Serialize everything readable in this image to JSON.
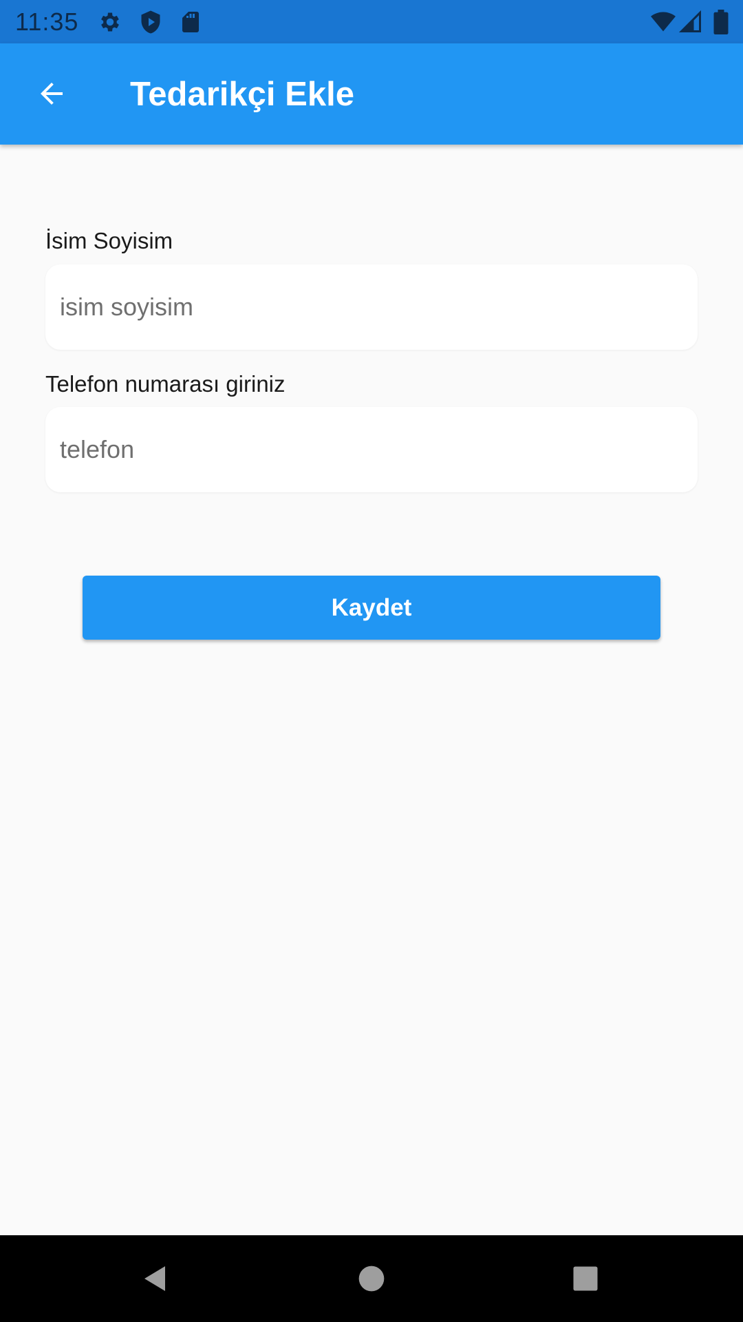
{
  "status_bar": {
    "time": "11:35",
    "icons": [
      "settings-icon",
      "shield-play-icon",
      "sd-card-icon",
      "wifi-icon",
      "signal-icon",
      "battery-icon"
    ]
  },
  "app_bar": {
    "title": "Tedarikçi Ekle",
    "back_icon": "arrow-left-icon",
    "color": "#2196f3"
  },
  "form": {
    "name": {
      "label": "İsim Soyisim",
      "placeholder": "isim soyisim",
      "value": ""
    },
    "phone": {
      "label": "Telefon numarası giriniz",
      "placeholder": "telefon",
      "value": ""
    },
    "save_label": "Kaydet"
  },
  "nav_bar": {
    "icons": [
      "back-triangle-icon",
      "home-circle-icon",
      "recents-square-icon"
    ]
  },
  "colors": {
    "status_bar": "#1976d2",
    "primary": "#2196f3",
    "background": "#fafafa"
  }
}
